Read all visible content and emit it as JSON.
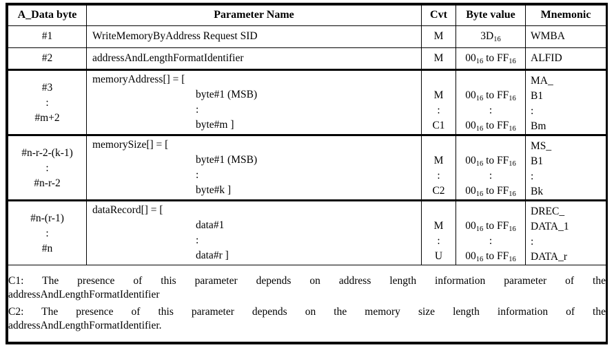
{
  "table": {
    "headers": {
      "a_data_byte": "A_Data byte",
      "parameter_name": "Parameter Name",
      "cvt": "Cvt",
      "byte_value": "Byte value",
      "mnemonic": "Mnemonic"
    },
    "simple_rows": [
      {
        "a_data_byte": "#1",
        "parameter_name": "WriteMemoryByAddress Request SID",
        "cvt": "M",
        "byte_value_prefix": "3D",
        "byte_value_sub": "16",
        "byte_value_suffix": "",
        "byte_value_prefix2": "",
        "byte_value_sub2": "",
        "mnemonic": "WMBA"
      },
      {
        "a_data_byte": "#2",
        "parameter_name": "addressAndLengthFormatIdentifier",
        "cvt": "M",
        "byte_value_prefix": "00",
        "byte_value_sub": "16",
        "byte_value_mid": " to FF",
        "byte_value_sub2": "16",
        "mnemonic": "ALFID"
      }
    ],
    "block_rows": [
      {
        "adb_first": "#3",
        "adb_dots": ":",
        "adb_last": "#m+2",
        "pname_header": "memoryAddress[] = [",
        "pname_first": "byte#1 (MSB)",
        "pname_dots": ":",
        "pname_last": "byte#m ]",
        "cvt_first": "M",
        "cvt_dots": ":",
        "cvt_last": "C1",
        "byte_first_a": "00",
        "byte_first_sub_a": "16",
        "byte_first_mid": " to FF",
        "byte_first_sub_b": "16",
        "byte_dots": ":",
        "byte_last_a": "00",
        "byte_last_sub_a": "16",
        "byte_last_mid": " to FF",
        "byte_last_sub_b": "16",
        "mnem_l1": "MA_",
        "mnem_l2": "B1",
        "mnem_l3": ":",
        "mnem_l4": "Bm"
      },
      {
        "adb_first": "#n-r-2-(k-1)",
        "adb_dots": ":",
        "adb_last": "#n-r-2",
        "pname_header": "memorySize[] = [",
        "pname_first": "byte#1 (MSB)",
        "pname_dots": ":",
        "pname_last": "byte#k ]",
        "cvt_first": "M",
        "cvt_dots": ":",
        "cvt_last": "C2",
        "byte_first_a": "00",
        "byte_first_sub_a": "16",
        "byte_first_mid": " to FF",
        "byte_first_sub_b": "16",
        "byte_dots": ":",
        "byte_last_a": "00",
        "byte_last_sub_a": "16",
        "byte_last_mid": " to FF",
        "byte_last_sub_b": "16",
        "mnem_l1": "MS_",
        "mnem_l2": "B1",
        "mnem_l3": ":",
        "mnem_l4": "Bk"
      },
      {
        "adb_first": "#n-(r-1)",
        "adb_dots": ":",
        "adb_last": "#n",
        "pname_header": "dataRecord[] = [",
        "pname_first": "data#1",
        "pname_dots": ":",
        "pname_last": "data#r ]",
        "cvt_first": "M",
        "cvt_dots": ":",
        "cvt_last": "U",
        "byte_first_a": "00",
        "byte_first_sub_a": "16",
        "byte_first_mid": " to FF",
        "byte_first_sub_b": "16",
        "byte_dots": ":",
        "byte_last_a": "00",
        "byte_last_sub_a": "16",
        "byte_last_mid": " to FF",
        "byte_last_sub_b": "16",
        "mnem_l1": "DREC_",
        "mnem_l2": "DATA_1",
        "mnem_l3": ":",
        "mnem_l4": "DATA_r"
      }
    ],
    "footnotes": {
      "c1_main": "C1: The presence of this parameter depends on address length information parameter of the",
      "c1_tail": "addressAndLengthFormatIdentifier",
      "c2_main": "C2: The presence of this parameter depends on the memory size length information of the",
      "c2_tail": "addressAndLengthFormatIdentifier."
    }
  },
  "colors": {
    "border": "#000000",
    "text": "#000000",
    "background": "#ffffff"
  }
}
